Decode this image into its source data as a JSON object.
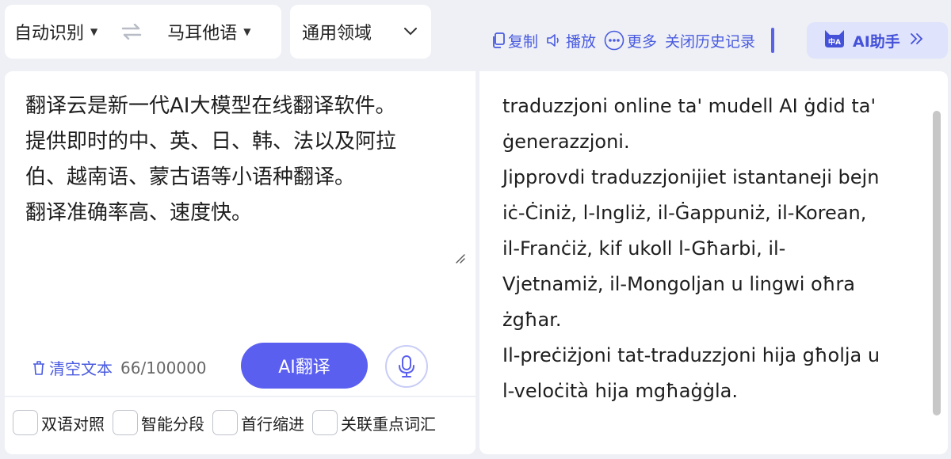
{
  "lang_bar": {
    "source_lang": "自动识别",
    "target_lang": "马耳他语",
    "domain": "通用领域"
  },
  "toolbar": {
    "copy_label": "复制",
    "play_label": "播放",
    "more_label": "更多",
    "close_history_label": "关闭历史记录",
    "ai_assistant_label": "AI助手",
    "ai_assistant_badge": "中A"
  },
  "source": {
    "text": "翻译云是新一代AI大模型在线翻译软件。\n提供即时的中、英、日、韩、法以及阿拉\n伯、越南语、蒙古语等小语种翻译。\n翻译准确率高、速度快。",
    "clear_label": "清空文本",
    "char_count": "66/100000",
    "translate_button": "AI翻译"
  },
  "options": [
    {
      "label": "双语对照",
      "checked": false
    },
    {
      "label": "智能分段",
      "checked": false
    },
    {
      "label": "首行缩进",
      "checked": false
    },
    {
      "label": "关联重点词汇",
      "checked": false
    }
  ],
  "target": {
    "text": "traduzzjoni online ta' mudell AI ġdid ta'\nġenerazzjoni.\nJipprovdi traduzzjonijiet istantaneji bejn\niċ-Ċiniż, l-Ingliż, il-Ġappuniż, il-Korean,\nil-Franċiż, kif ukoll l-Għarbi, il-\nVjetnamiż, il-Mongoljan u lingwi oħra\nżgħar.\nIl-preċiżjoni tat-traduzzjoni hija għolja u\nl-veloċità hija mgħaġġla."
  },
  "colors": {
    "accent": "#5a5ff0",
    "link": "#4a5be0",
    "background": "#eef0f5"
  }
}
